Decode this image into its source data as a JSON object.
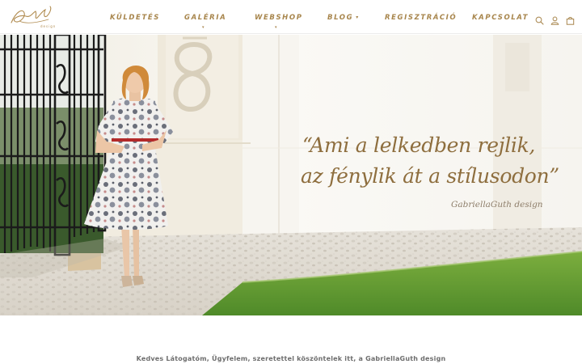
{
  "brand": {
    "logo_script": "Gabriella Guth",
    "logo_tag": "design"
  },
  "nav": {
    "items": [
      {
        "label": "KÜLDETÉS"
      },
      {
        "label": "GALÉRIA",
        "has_dropdown": true
      },
      {
        "label": "WEBSHOP",
        "has_dropdown": true
      },
      {
        "label": "BLOG",
        "has_dropdown": true
      },
      {
        "label": "REGISZTRÁCIÓ"
      },
      {
        "label": "KAPCSOLAT"
      }
    ],
    "caret_glyph": "▾",
    "icons": [
      "search-icon",
      "user-icon",
      "cart-icon"
    ]
  },
  "hero": {
    "quote_line1": "“Ami a lelkedben rejlik,",
    "quote_line2": "az fénylik át a stílusodon”",
    "signature": "GabriellaGuth design"
  },
  "intro": {
    "text": "Kedves Látogatóm, Ügyfelem, szeretettel köszöntelek itt, a GabriellaGuth design"
  },
  "colors": {
    "accent_gold": "#a8864d",
    "quote_color": "#8e6e3e"
  }
}
